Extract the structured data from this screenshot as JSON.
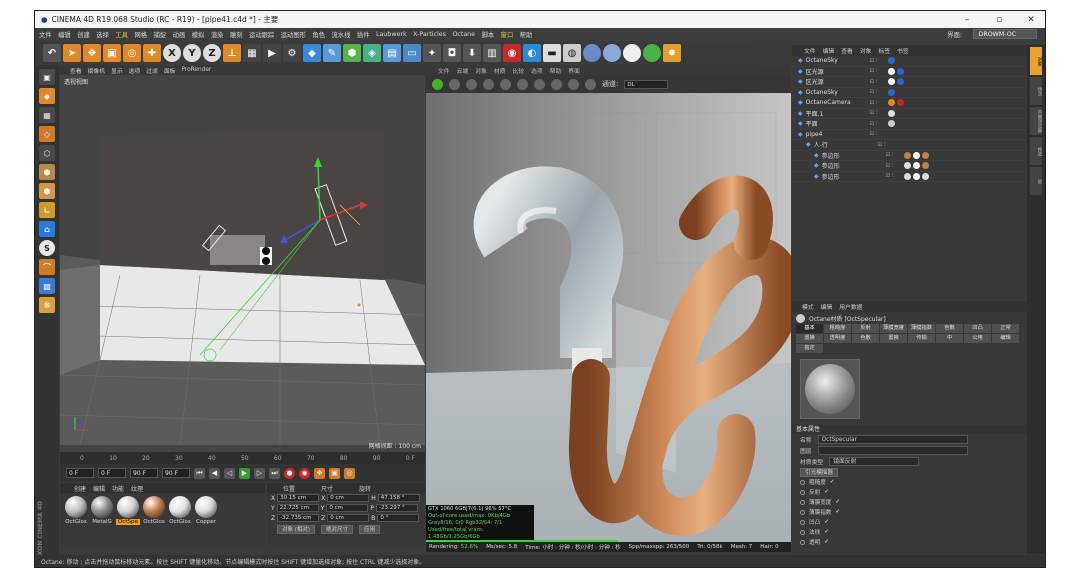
{
  "window": {
    "title": "CINEMA 4D R19.068 Studio (RC - R19) - [pipe41.c4d *] - 主要",
    "minimize": "–",
    "maximize": "▫",
    "close": "✕"
  },
  "menu": [
    "文件",
    "编辑",
    "创建",
    "选择",
    "工具",
    "网格",
    "捕捉",
    "动画",
    "模拟",
    "渲染",
    "雕刻",
    "运动跟踪",
    "运动图形",
    "角色",
    "流水线",
    "插件",
    "Laubwerk",
    "X-Particles",
    "Octane",
    "脚本",
    "窗口",
    "帮助"
  ],
  "layout": {
    "label": "界面:",
    "value": "DROWM-OC"
  },
  "viewport": {
    "menu": [
      "查看",
      "摄像机",
      "显示",
      "选项",
      "过滤",
      "面板",
      "ProRender"
    ],
    "label": "透视视图",
    "grid": "网格间距 : 100 cm"
  },
  "timeline": {
    "ticks": [
      "0",
      "10",
      "20",
      "30",
      "40",
      "50",
      "60",
      "70",
      "80",
      "90"
    ],
    "end_frame": "0 F",
    "start": "0 F",
    "cur": "0 F",
    "end": "90 F",
    "end2": "90 F"
  },
  "materials": {
    "menu": [
      "创建",
      "编辑",
      "功能",
      "纹理"
    ],
    "items": [
      {
        "name": "OctGlos",
        "color": "#bdbdbd"
      },
      {
        "name": "MetalG",
        "color": "#8a8a8a"
      },
      {
        "name": "OctSpe",
        "color": "#d0d0d0"
      },
      {
        "name": "OctGlos",
        "color": "#c0784a"
      },
      {
        "name": "OctGlos",
        "color": "#e0e0e0"
      },
      {
        "name": "Copper",
        "color": "#d8d8d8"
      }
    ],
    "selected_index": 2,
    "brand": "MAXON CINEMA 4D"
  },
  "coords": {
    "headers": [
      "位置",
      "尺寸",
      "旋转"
    ],
    "rows": [
      {
        "axis": "X",
        "pos": "30.15 cm",
        "size": "0 cm",
        "rot_label": "H",
        "rot": "47.158 °"
      },
      {
        "axis": "Y",
        "pos": "22.725 cm",
        "size": "0 cm",
        "rot_label": "P",
        "rot": "-23.297 °"
      },
      {
        "axis": "Z",
        "pos": "-32.735 cm",
        "size": "0 cm",
        "rot_label": "B",
        "rot": "0 °"
      }
    ],
    "mode": "对象 (相对)",
    "size_mode": "绝对尺寸",
    "apply": "应用"
  },
  "render": {
    "menu": [
      "文件",
      "云端",
      "对象",
      "材质",
      "比较",
      "选项",
      "帮助",
      "界面"
    ],
    "dropdown": "DL",
    "preset_label": "通道:",
    "stats": [
      "GTX 1060 6GB[T(6.1)     96%     57°C",
      "Out-of-core used/max: 0Kb/4Gb",
      "Grey8/16: 0/0          Rgb32/64: 7/1",
      "Used/free/total vram: 1.48Gb/1.25Gb/6Gb"
    ],
    "status": {
      "progress_label": "Rendering:",
      "progress": "52.6%",
      "speed": "Ms/sec: 5.8",
      "time": "Time: 小时 : 分钟 : 秒/小时 : 分钟 : 秒",
      "spp": "Spp/maxspp: 263/500",
      "tri": "Tri: 0/58k",
      "mesh": "Mesh: 7",
      "hair": "Hair: 0"
    },
    "progress_value": 0.526
  },
  "objects": {
    "menu": [
      "文件",
      "编辑",
      "查看",
      "对象",
      "标签",
      "书签"
    ],
    "rows": [
      {
        "name": "OctaneSky",
        "indent": 0,
        "tags": [
          "#2a66c8"
        ]
      },
      {
        "name": "区光源",
        "indent": 0,
        "tags": [
          "#ffffff",
          "#2a66c8"
        ]
      },
      {
        "name": "区光源",
        "indent": 0,
        "tags": [
          "#ffffff",
          "#2a66c8"
        ]
      },
      {
        "name": "OctaneSky",
        "indent": 0,
        "tags": [
          "#2a66c8"
        ]
      },
      {
        "name": "OctaneCamera",
        "indent": 0,
        "tags": [
          "#e08a20",
          "#cc2222"
        ]
      },
      {
        "name": "平面.1",
        "indent": 0,
        "tags": [
          "#e0e0e0"
        ]
      },
      {
        "name": "平面",
        "indent": 0,
        "tags": [
          "#cccccc"
        ]
      },
      {
        "name": "pipe4",
        "indent": 0,
        "tags": []
      },
      {
        "name": "人-行",
        "indent": 1,
        "tags": []
      },
      {
        "name": "参边形",
        "indent": 2,
        "tags": [
          "#c08040",
          "#ffffff",
          "#c08040"
        ]
      },
      {
        "name": "参边形",
        "indent": 2,
        "tags": [
          "#dddddd",
          "#ffffff",
          "#c08040"
        ]
      },
      {
        "name": "参边形",
        "indent": 2,
        "tags": [
          "#dddddd",
          "#ffffff",
          "#dddddd"
        ]
      }
    ]
  },
  "attributes": {
    "menu": [
      "模式",
      "编辑",
      "用户数据"
    ],
    "title": "Octane材质 [OctSpecular]",
    "tabs": [
      "基本",
      "粗糙度",
      "反射",
      "薄膜宽度",
      "薄膜指数",
      "色散",
      "凹凸",
      "正常",
      "置换",
      "透明度",
      "色散",
      "置换",
      "传输",
      "中",
      "公用",
      "编辑",
      "指定"
    ],
    "active_tab": 0,
    "section": "基本属性",
    "name_label": "名称",
    "name_value": "OctSpecular",
    "layer_label": "图层",
    "type_label": "材质类型",
    "type_value": "镜面反射",
    "subbtn": "引光模描器",
    "channels": [
      "粗糙度",
      "反射",
      "薄膜宽度",
      "薄膜指数",
      "凹凸",
      "法线",
      "透明"
    ]
  },
  "right_tabs": [
    "对象",
    "场次",
    "内容浏览器",
    "构造",
    "层"
  ],
  "statusbar": "Octane: 移动 : 点击并拖动鼠标移动元素。按住 SHIFT 键量化移动。节点编辑模式时按住 SHIFT 键增加选择对象; 按住 CTRL 键减少选择对象。"
}
